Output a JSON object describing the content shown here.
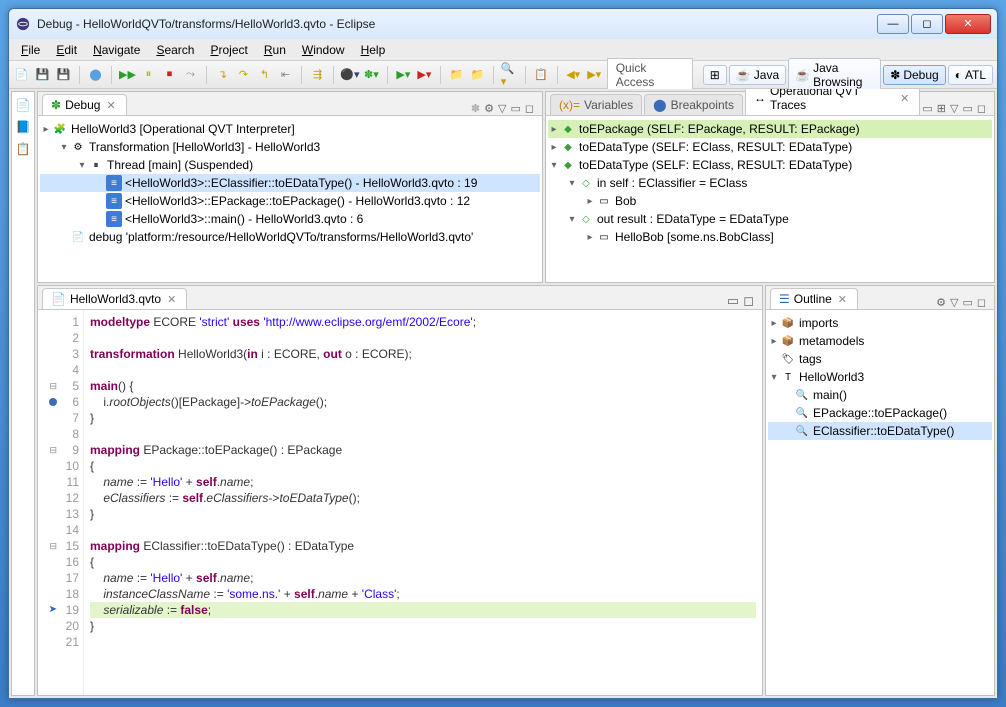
{
  "title": "Debug - HelloWorldQVTo/transforms/HelloWorld3.qvto - Eclipse",
  "menus": [
    "File",
    "Edit",
    "Navigate",
    "Search",
    "Project",
    "Run",
    "Window",
    "Help"
  ],
  "quick_access": "Quick Access",
  "perspectives": [
    {
      "label": "Java",
      "active": false
    },
    {
      "label": "Java Browsing",
      "active": false
    },
    {
      "label": "Debug",
      "active": true
    },
    {
      "label": "ATL",
      "active": false
    }
  ],
  "debug_view": {
    "tab": "Debug",
    "tree": [
      {
        "indent": 0,
        "tw": "▸",
        "icon": "🧩",
        "text": "HelloWorld3 [Operational QVT Interpreter]",
        "sel": false
      },
      {
        "indent": 1,
        "tw": "▾",
        "icon": "⚙",
        "text": "Transformation [HelloWorld3] - HelloWorld3",
        "sel": false
      },
      {
        "indent": 2,
        "tw": "▾",
        "icon": "⏸",
        "text": "Thread [main] (Suspended)",
        "sel": false
      },
      {
        "indent": 3,
        "tw": "",
        "icon": "≡",
        "text": "<HelloWorld3>::EClassifier::toEDataType() - HelloWorld3.qvto : 19",
        "sel": true
      },
      {
        "indent": 3,
        "tw": "",
        "icon": "≡",
        "text": "<HelloWorld3>::EPackage::toEPackage() - HelloWorld3.qvto : 12",
        "sel": false
      },
      {
        "indent": 3,
        "tw": "",
        "icon": "≡",
        "text": "<HelloWorld3>::main() - HelloWorld3.qvto : 6",
        "sel": false
      },
      {
        "indent": 1,
        "tw": "",
        "icon": "📄",
        "text": "debug 'platform:/resource/HelloWorldQVTo/transforms/HelloWorld3.qvto'",
        "sel": false
      }
    ]
  },
  "vars_view": {
    "tabs": [
      {
        "label": "Variables",
        "active": false,
        "icon": "(x)="
      },
      {
        "label": "Breakpoints",
        "active": false,
        "icon": "⬤"
      },
      {
        "label": "Operational QVT Traces",
        "active": true,
        "icon": "↔"
      }
    ],
    "tree": [
      {
        "indent": 0,
        "tw": "▸",
        "icon": "◆",
        "text": "toEPackage (SELF: EPackage, RESULT: EPackage)",
        "hl": true
      },
      {
        "indent": 0,
        "tw": "▸",
        "icon": "◆",
        "text": "toEDataType (SELF: EClass, RESULT: EDataType)"
      },
      {
        "indent": 0,
        "tw": "▾",
        "icon": "◆",
        "text": "toEDataType (SELF: EClass, RESULT: EDataType)"
      },
      {
        "indent": 1,
        "tw": "▾",
        "icon": "◇",
        "text": "in self : EClassifier = EClass"
      },
      {
        "indent": 2,
        "tw": "▸",
        "icon": "▭",
        "text": "Bob"
      },
      {
        "indent": 1,
        "tw": "▾",
        "icon": "◇",
        "text": "out result : EDataType = EDataType"
      },
      {
        "indent": 2,
        "tw": "▸",
        "icon": "▭",
        "text": "HelloBob [some.ns.BobClass]"
      }
    ]
  },
  "editor": {
    "tab_label": "HelloWorld3.qvto",
    "lines": [
      {
        "n": 1,
        "html": "<span class='kw'>modeltype</span> ECORE <span class='str'>'strict'</span> <span class='kw'>uses</span> <span class='str'>'http://www.eclipse.org/emf/2002/Ecore'</span>;"
      },
      {
        "n": 2,
        "html": ""
      },
      {
        "n": 3,
        "html": "<span class='kw'>transformation</span> HelloWorld3(<span class='kw'>in</span> i : ECORE, <span class='kw'>out</span> o : ECORE);"
      },
      {
        "n": 4,
        "html": ""
      },
      {
        "n": 5,
        "html": "<span class='kw'>main</span>() {",
        "fold": true
      },
      {
        "n": 6,
        "html": "    i.<span class='it'>rootObjects</span>()[EPackage]-&gt;<span class='it'>toEPackage</span>();",
        "bp": true
      },
      {
        "n": 7,
        "html": "}"
      },
      {
        "n": 8,
        "html": ""
      },
      {
        "n": 9,
        "html": "<span class='kw'>mapping</span> EPackage::toEPackage() : EPackage",
        "fold": true
      },
      {
        "n": 10,
        "html": "{"
      },
      {
        "n": 11,
        "html": "    <span class='it'>name</span> := <span class='str'>'Hello'</span> + <span class='kw'>self</span>.<span class='it'>name</span>;"
      },
      {
        "n": 12,
        "html": "    <span class='it'>eClassifiers</span> := <span class='kw'>self</span>.<span class='it'>eClassifiers</span>-&gt;<span class='it'>toEDataType</span>();"
      },
      {
        "n": 13,
        "html": "}"
      },
      {
        "n": 14,
        "html": ""
      },
      {
        "n": 15,
        "html": "<span class='kw'>mapping</span> EClassifier::toEDataType() : EDataType",
        "fold": true
      },
      {
        "n": 16,
        "html": "{"
      },
      {
        "n": 17,
        "html": "    <span class='it'>name</span> := <span class='str'>'Hello'</span> + <span class='kw'>self</span>.<span class='it'>name</span>;"
      },
      {
        "n": 18,
        "html": "    <span class='it'>instanceClassName</span> := <span class='str'>'some.ns.'</span> + <span class='kw'>self</span>.<span class='it'>name</span> + <span class='str'>'Class'</span>;"
      },
      {
        "n": 19,
        "html": "    <span class='it'>serializable</span> := <span class='kw'>false</span>;",
        "current": true,
        "arrow": true
      },
      {
        "n": 20,
        "html": "}"
      },
      {
        "n": 21,
        "html": ""
      }
    ]
  },
  "outline": {
    "tab": "Outline",
    "tree": [
      {
        "indent": 0,
        "tw": "▸",
        "icon": "📦",
        "text": "imports"
      },
      {
        "indent": 0,
        "tw": "▸",
        "icon": "📦",
        "text": "metamodels"
      },
      {
        "indent": 0,
        "tw": "",
        "icon": "🏷",
        "text": "tags"
      },
      {
        "indent": 0,
        "tw": "▾",
        "icon": "T",
        "text": "HelloWorld3"
      },
      {
        "indent": 1,
        "tw": "",
        "icon": "🔍",
        "text": "main()"
      },
      {
        "indent": 1,
        "tw": "",
        "icon": "🔍",
        "text": "EPackage::toEPackage()"
      },
      {
        "indent": 1,
        "tw": "",
        "icon": "🔍",
        "text": "EClassifier::toEDataType()",
        "sel": true
      }
    ]
  }
}
